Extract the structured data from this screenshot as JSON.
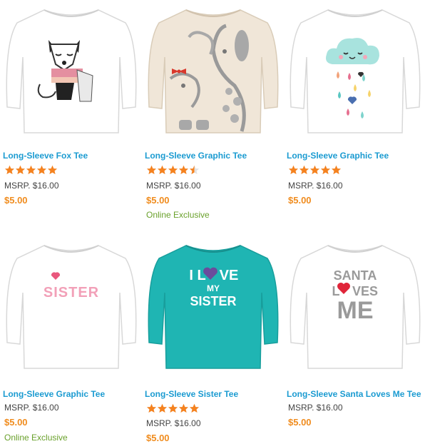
{
  "colors": {
    "title": "#1b9bd1",
    "price": "#f08c1e",
    "star": "#f5821f",
    "exclusive": "#6aa12c",
    "teal_shirt": "#1fb5b3"
  },
  "products": [
    {
      "title": "Long-Sleeve Fox Tee",
      "rating": 5,
      "msrp": "MSRP. $16.00",
      "price": "$5.00",
      "badge": "",
      "shirt_color": "#ffffff",
      "graphic": "fox"
    },
    {
      "title": "Long-Sleeve Graphic Tee",
      "rating": 4.5,
      "msrp": "MSRP. $16.00",
      "price": "$5.00",
      "badge": "Online Exclusive",
      "shirt_color": "#f0e6d8",
      "graphic": "dogs"
    },
    {
      "title": "Long-Sleeve Graphic Tee",
      "rating": 5,
      "msrp": "MSRP. $16.00",
      "price": "$5.00",
      "badge": "",
      "shirt_color": "#ffffff",
      "graphic": "rain-cloud"
    },
    {
      "title": "Long-Sleeve Graphic Tee",
      "rating": null,
      "msrp": "MSRP. $16.00",
      "price": "$5.00",
      "badge": "Online Exclusive",
      "shirt_color": "#ffffff",
      "graphic": "sister-text",
      "graphic_text": "SISTER"
    },
    {
      "title": "Long-Sleeve Sister Tee",
      "rating": 5,
      "msrp": "MSRP. $16.00",
      "price": "$5.00",
      "badge": "",
      "shirt_color": "#1fb5b3",
      "graphic": "i-love-my-sister",
      "graphic_text": [
        "I L",
        "VE",
        "MY",
        "SISTER"
      ]
    },
    {
      "title": "Long-Sleeve Santa Loves Me Tee",
      "rating": null,
      "msrp": "MSRP. $16.00",
      "price": "$5.00",
      "badge": "",
      "shirt_color": "#ffffff",
      "graphic": "santa-loves-me",
      "graphic_text": [
        "SANTA",
        "L",
        "VES",
        "ME"
      ]
    }
  ]
}
